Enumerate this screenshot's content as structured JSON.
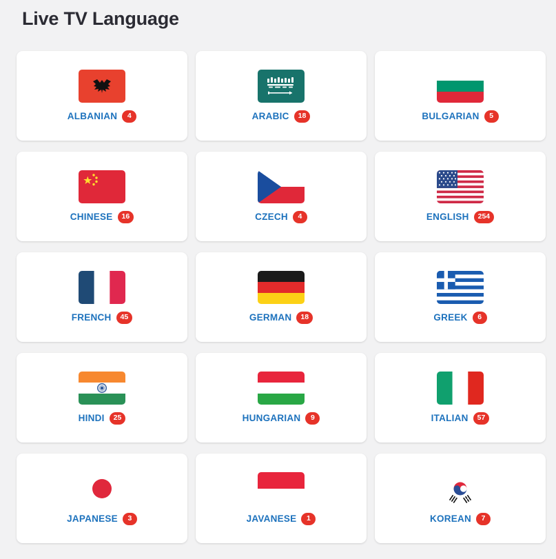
{
  "header": {
    "title": "Live TV Language"
  },
  "colors": {
    "page_background": "#f2f2f3",
    "card_background": "#ffffff",
    "label_blue": "#1d72bd",
    "badge_red": "#e63329",
    "title_text": "#2b2b33"
  },
  "languages": [
    {
      "name": "ALBANIAN",
      "count": "4",
      "flag": "albania-flag-icon"
    },
    {
      "name": "ARABIC",
      "count": "18",
      "flag": "saudi-arabia-flag-icon"
    },
    {
      "name": "BULGARIAN",
      "count": "5",
      "flag": "bulgaria-flag-icon"
    },
    {
      "name": "CHINESE",
      "count": "16",
      "flag": "china-flag-icon"
    },
    {
      "name": "CZECH",
      "count": "4",
      "flag": "czech-republic-flag-icon"
    },
    {
      "name": "ENGLISH",
      "count": "254",
      "flag": "united-states-flag-icon"
    },
    {
      "name": "FRENCH",
      "count": "45",
      "flag": "france-flag-icon"
    },
    {
      "name": "GERMAN",
      "count": "18",
      "flag": "germany-flag-icon"
    },
    {
      "name": "GREEK",
      "count": "6",
      "flag": "greece-flag-icon"
    },
    {
      "name": "HINDI",
      "count": "25",
      "flag": "india-flag-icon"
    },
    {
      "name": "HUNGARIAN",
      "count": "9",
      "flag": "hungary-flag-icon"
    },
    {
      "name": "ITALIAN",
      "count": "57",
      "flag": "italy-flag-icon"
    },
    {
      "name": "JAPANESE",
      "count": "3",
      "flag": "japan-flag-icon"
    },
    {
      "name": "JAVANESE",
      "count": "1",
      "flag": "indonesia-flag-icon"
    },
    {
      "name": "KOREAN",
      "count": "7",
      "flag": "south-korea-flag-icon"
    }
  ]
}
